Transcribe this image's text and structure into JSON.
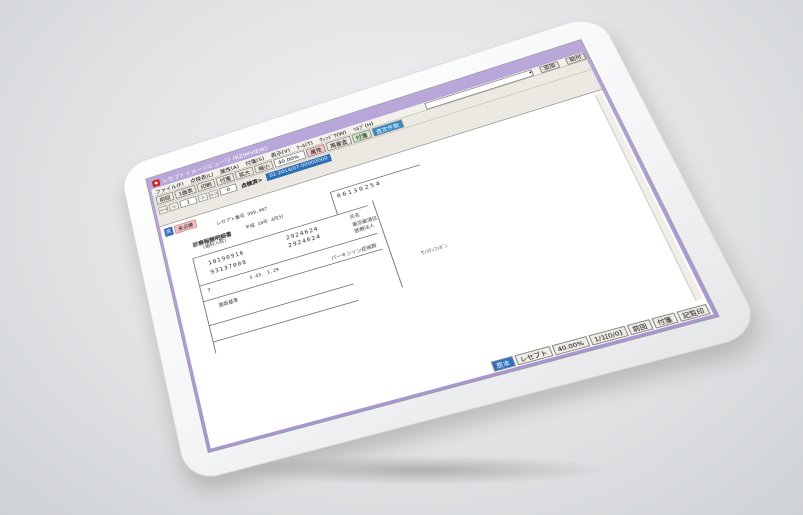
{
  "window": {
    "title": "レセプトイメージビューワ (RZIMVIEW)"
  },
  "menu": {
    "items": [
      "ファイル(F)",
      "点検表(L)",
      "属性(A)",
      "付箋(S)",
      "表示(V)",
      "ﾂｰﾙ(T)",
      "ｳｨﾝﾄﾞｳ(W)",
      "ﾍﾙﾌﾟ(H)"
    ],
    "search_button": "追加",
    "attach_button": "貼付"
  },
  "toolbar": {
    "prev": "前回",
    "mode": "1面表",
    "print": "印刷",
    "attach": "付箋",
    "zoom_in": "拡大",
    "zoom_out": "縮小",
    "zoom_value": "40.00%",
    "attr": "属性",
    "redisplay": "再審査",
    "tag": "付箋",
    "review": "査定件数"
  },
  "nav": {
    "first": "<<",
    "prev": "<",
    "page": "1",
    "next": ">",
    "last": ">>",
    "sub_page": "0",
    "status": "点検済>",
    "doc_id": "01-2014/07-00000000"
  },
  "document": {
    "mark1": "戻",
    "mark2": "未点検",
    "header_text": "レセプト番号 999,907",
    "category": "診療報酬明細書",
    "era": "平成 18年 4月分",
    "type": "(歯科入院)",
    "insurer_no": "06130254",
    "code1": "10190916",
    "code2": "93137008",
    "code3": "2924624",
    "code4": "2924624",
    "code5": "3",
    "dob": "3.43. 1.29",
    "name_label": "氏名",
    "address": "東京都港区",
    "facility": "医療法人",
    "side_text": "ｻﾝﾏﾃｨﾌﾝﾎﾞﾝ",
    "parkinson": "パーキンソン症候群",
    "flag": "施設基準"
  },
  "status": {
    "genpon": "原本",
    "receipt": "レセプト",
    "zoom": "40.00%",
    "pages": "1/1[0/0]",
    "prev": "前回",
    "tag": "付箋",
    "rec": "記覧印"
  }
}
